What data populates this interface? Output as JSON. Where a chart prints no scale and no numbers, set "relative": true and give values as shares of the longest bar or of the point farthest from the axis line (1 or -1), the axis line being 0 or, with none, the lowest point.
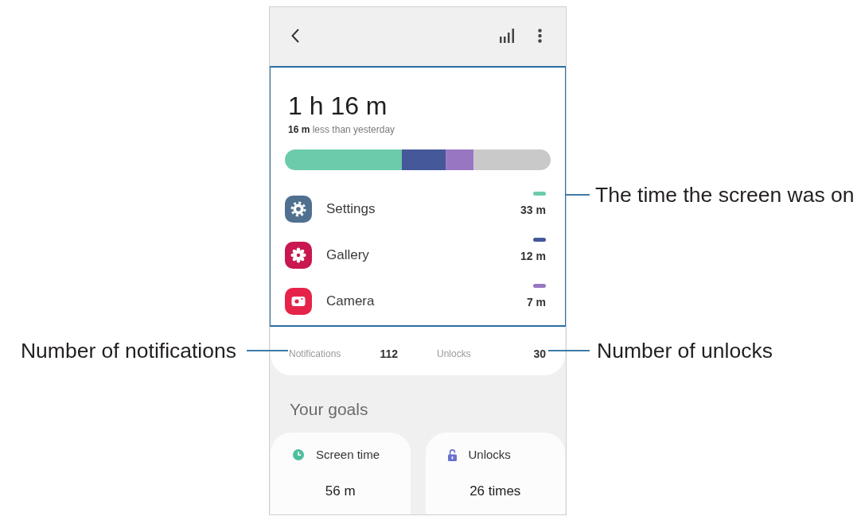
{
  "screen_time": {
    "total": "1 h 16 m",
    "comparison": "**16 m** less than yesterday",
    "chart_data": [
      {
        "type": "bar",
        "orientation": "horizontal",
        "stacked": true,
        "relative": true,
        "categories": [
          null
        ],
        "series": [
          {
            "color": "#6ccbab",
            "values": [
              0.44
            ]
          },
          {
            "color": "#44589a",
            "values": [
              0.165
            ]
          },
          {
            "color": "#9876c2",
            "values": [
              0.105
            ]
          },
          {
            "color": "#c9c9c9",
            "values": [
              0.29
            ]
          }
        ]
      }
    ]
  },
  "apps": [
    {
      "name": "Settings",
      "time": "33 m",
      "color": "#6ccbab"
    },
    {
      "name": "Gallery",
      "time": "12 m",
      "color": "#44589a"
    },
    {
      "name": "Camera",
      "time": "7 m",
      "color": "#9876c2"
    }
  ],
  "stats": [
    {
      "label": "Notifications",
      "value": "112"
    },
    {
      "label": "Unlocks",
      "value": "30"
    }
  ],
  "goals": {
    "title": "Your goals",
    "items": [
      {
        "label": "Screen time",
        "value": "56 m"
      },
      {
        "label": "Unlocks",
        "value": "26 times"
      }
    ]
  },
  "callouts": [
    {
      "text": "The time the screen was on"
    },
    {
      "text": "Number of notifications"
    },
    {
      "text": "Number of unlocks"
    }
  ]
}
